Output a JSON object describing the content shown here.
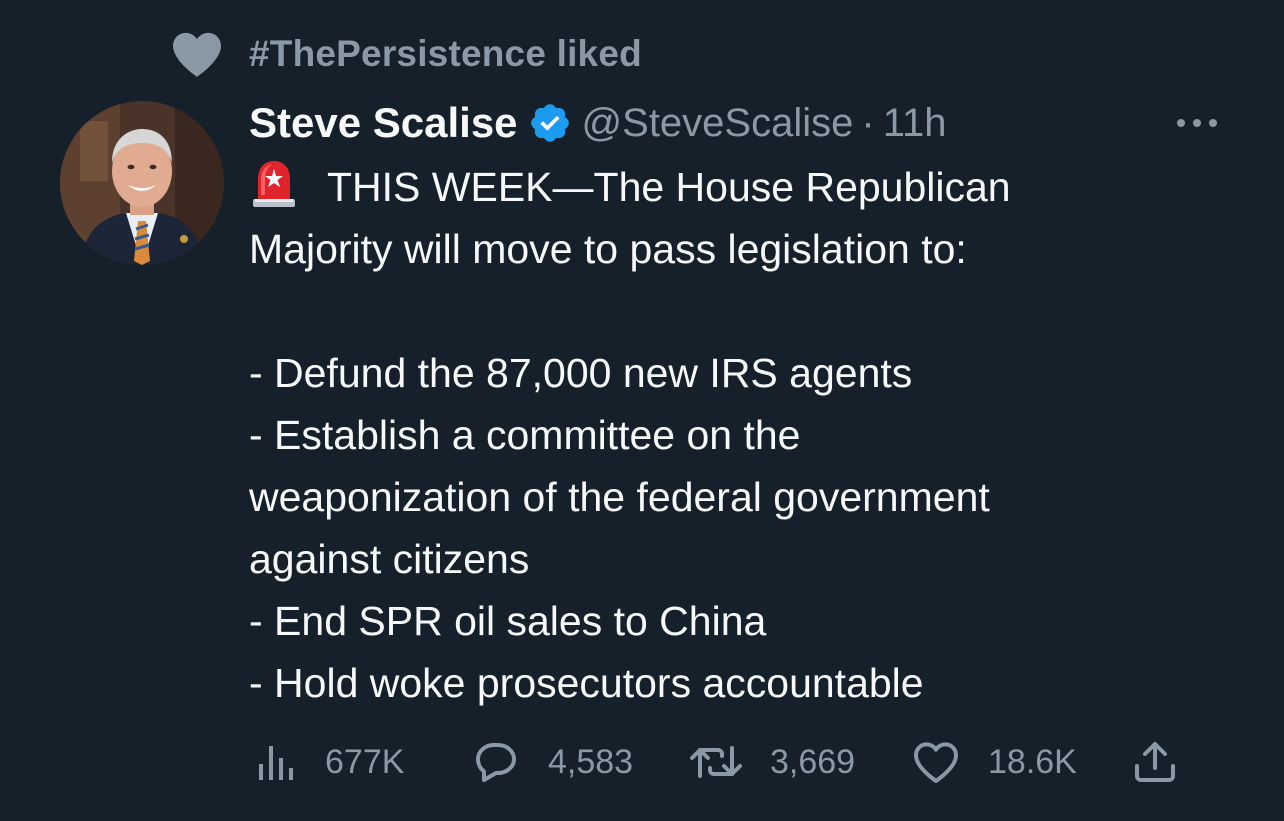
{
  "social_context": {
    "text": "#ThePersistence liked",
    "icon": "heart-icon"
  },
  "tweet": {
    "author": {
      "display_name": "Steve Scalise",
      "verified_icon": "verified-badge-icon",
      "handle": "@SteveScalise",
      "separator": "·",
      "time": "11h"
    },
    "more_icon": "more-options-icon",
    "siren_icon": "rotating-light-emoji",
    "lines": [
      "THIS WEEK—The House Republican",
      "Majority will move to pass legislation to:",
      "",
      "- Defund the 87,000 new IRS agents",
      "- Establish a committee on the",
      "weaponization of the federal government",
      "against citizens",
      "- End SPR oil sales to China",
      "- Hold woke prosecutors accountable"
    ],
    "actions": {
      "views": "677K",
      "replies": "4,583",
      "retweets": "3,669",
      "likes": "18.6K",
      "share_icon": "share-icon"
    }
  },
  "colors": {
    "background": "#15202b",
    "primary_text": "#f7f9f9",
    "secondary_text": "#8b98a5",
    "verified_blue": "#1d9bf0",
    "siren_red": "#e0242c"
  }
}
